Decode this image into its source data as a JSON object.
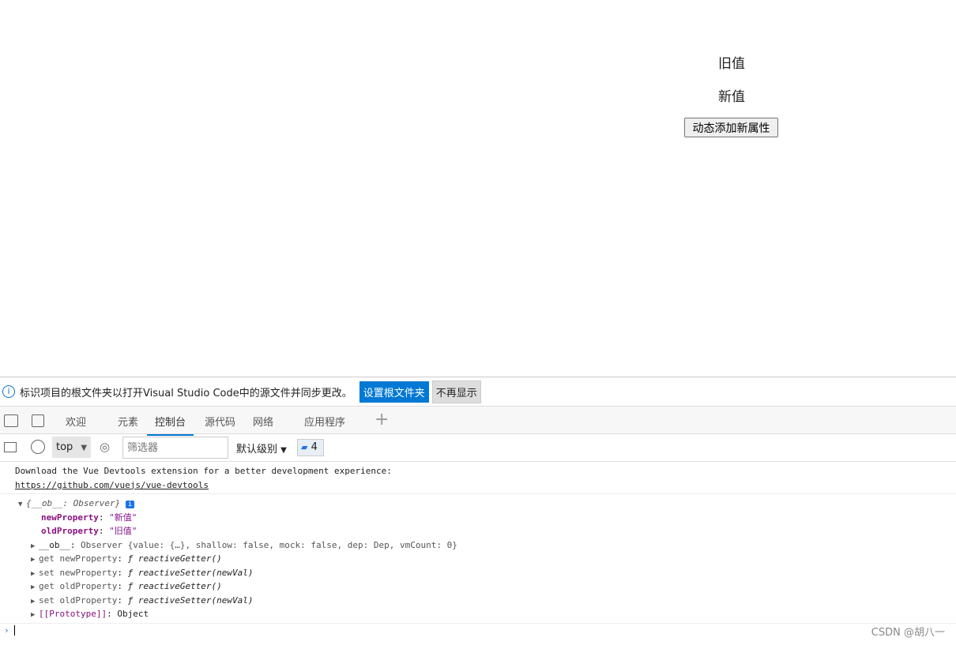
{
  "app": {
    "old_value": "旧值",
    "new_value": "新值",
    "add_button": "动态添加新属性"
  },
  "infobar": {
    "message": "标识项目的根文件夹以打开Visual Studio Code中的源文件并同步更改。",
    "set_root": "设置根文件夹",
    "dismiss": "不再显示"
  },
  "tabs": [
    "欢迎",
    "元素",
    "控制台",
    "源代码",
    "网络",
    "应用程序"
  ],
  "toolbar": {
    "context": "top",
    "filter_placeholder": "筛选器",
    "level": "默认级别",
    "message_count": "4"
  },
  "console": {
    "vue_msg": "Download the Vue Devtools extension for a better development experience:",
    "vue_link": "https://github.com/vuejs/vue-devtools",
    "obj_summary": "{__ob__: Observer}",
    "props": [
      {
        "key": "newProperty",
        "value": "\"新值\""
      },
      {
        "key": "oldProperty",
        "value": "\"旧值\""
      }
    ],
    "ob_line": {
      "key": "__ob__",
      "text": "Observer {value: {…}, shallow: false, mock: false, dep: Dep, vmCount: 0}"
    },
    "accessors": [
      {
        "key": "get newProperty",
        "value": "ƒ reactiveGetter()"
      },
      {
        "key": "set newProperty",
        "value": "ƒ reactiveSetter(newVal)"
      },
      {
        "key": "get oldProperty",
        "value": "ƒ reactiveGetter()"
      },
      {
        "key": "set oldProperty",
        "value": "ƒ reactiveSetter(newVal)"
      }
    ],
    "proto": {
      "key": "[[Prototype]]",
      "value": "Object"
    }
  },
  "watermark": "CSDN @胡八一"
}
